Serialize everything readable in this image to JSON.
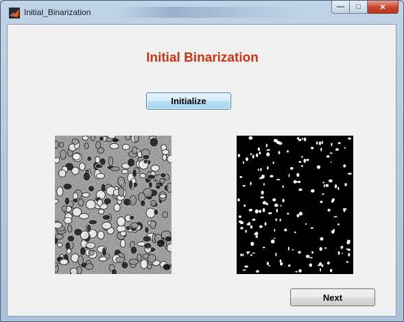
{
  "window": {
    "title": "Initial_Binarization",
    "buttons": {
      "minimize": "—",
      "maximize": "□",
      "close": "✕"
    },
    "icon": "matlab-icon"
  },
  "main": {
    "heading": "Initial Binarization",
    "initialize_label": "Initialize",
    "next_label": "Next",
    "images": [
      {
        "name": "original-microscopy-image",
        "kind": "grayscale"
      },
      {
        "name": "binarized-image",
        "kind": "binary"
      }
    ]
  },
  "colors": {
    "heading": "#cc3311",
    "client_bg": "#f0f0f0",
    "close_button": "#c9432a"
  }
}
